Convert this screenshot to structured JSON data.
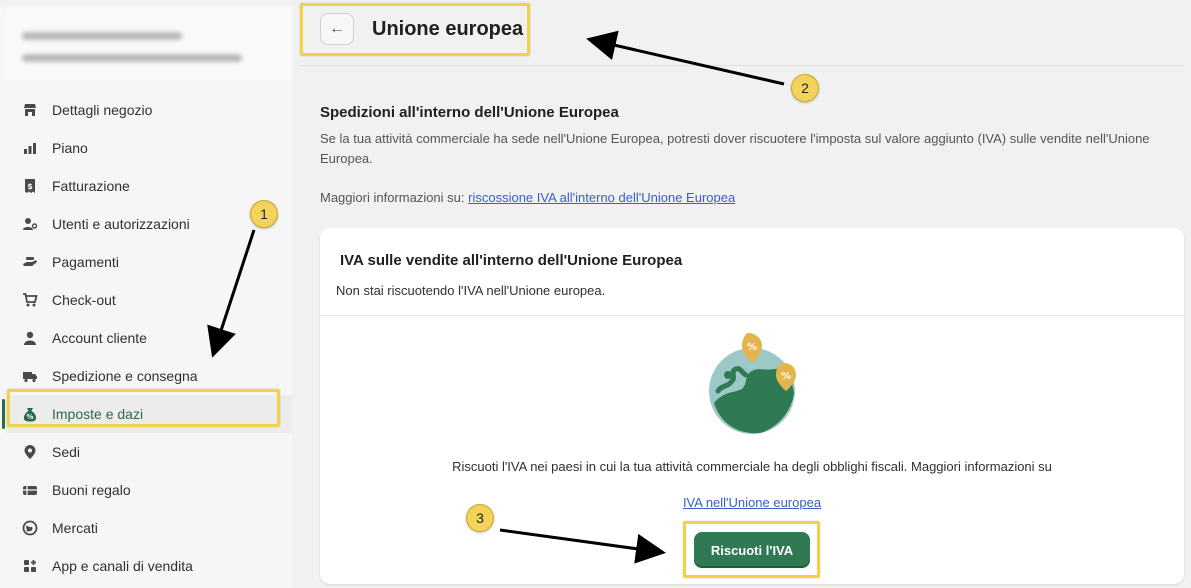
{
  "sidebar": {
    "items": [
      {
        "label": "Dettagli negozio",
        "icon": "store-icon"
      },
      {
        "label": "Piano",
        "icon": "plan-chart-icon"
      },
      {
        "label": "Fatturazione",
        "icon": "billing-receipt-icon"
      },
      {
        "label": "Utenti e autorizzazioni",
        "icon": "users-icon"
      },
      {
        "label": "Pagamenti",
        "icon": "payments-hand-icon"
      },
      {
        "label": "Check-out",
        "icon": "cart-icon"
      },
      {
        "label": "Account cliente",
        "icon": "person-icon"
      },
      {
        "label": "Spedizione e consegna",
        "icon": "truck-icon"
      },
      {
        "label": "Imposte e dazi",
        "icon": "tax-bag-icon"
      },
      {
        "label": "Sedi",
        "icon": "location-pin-icon"
      },
      {
        "label": "Buoni regalo",
        "icon": "gift-card-icon"
      },
      {
        "label": "Mercati",
        "icon": "globe-icon"
      },
      {
        "label": "App e canali di vendita",
        "icon": "apps-icon"
      }
    ],
    "active_index": 8
  },
  "header": {
    "title": "Unione europea",
    "back_icon": "arrow-left-icon"
  },
  "section": {
    "title": "Spedizioni all'interno dell'Unione Europea",
    "description": "Se la tua attività commerciale ha sede nell'Unione Europea, potresti dover riscuotere l'imposta sul valore aggiunto (IVA) sulle vendite nell'Unione Europea.",
    "more_info_prefix": "Maggiori informazioni su:",
    "more_info_link": "riscossione IVA all'interno dell'Unione Europea"
  },
  "card": {
    "title": "IVA sulle vendite all'interno dell'Unione Europea",
    "status": "Non stai riscuotendo l'IVA nell'Unione europea.",
    "empty_text": "Riscuoti l'IVA nei paesi in cui la tua attività commerciale ha degli obblighi fiscali. Maggiori informazioni su",
    "empty_link": "IVA nell'Unione europea",
    "cta_label": "Riscuoti l'IVA"
  },
  "annotations": {
    "badges": [
      "1",
      "2",
      "3"
    ],
    "highlight_color": "#f2d24b",
    "arrow_color": "#000000"
  },
  "colors": {
    "accent": "#2f7a52",
    "link": "#3b5ec8",
    "active_text": "#2b6a47"
  }
}
